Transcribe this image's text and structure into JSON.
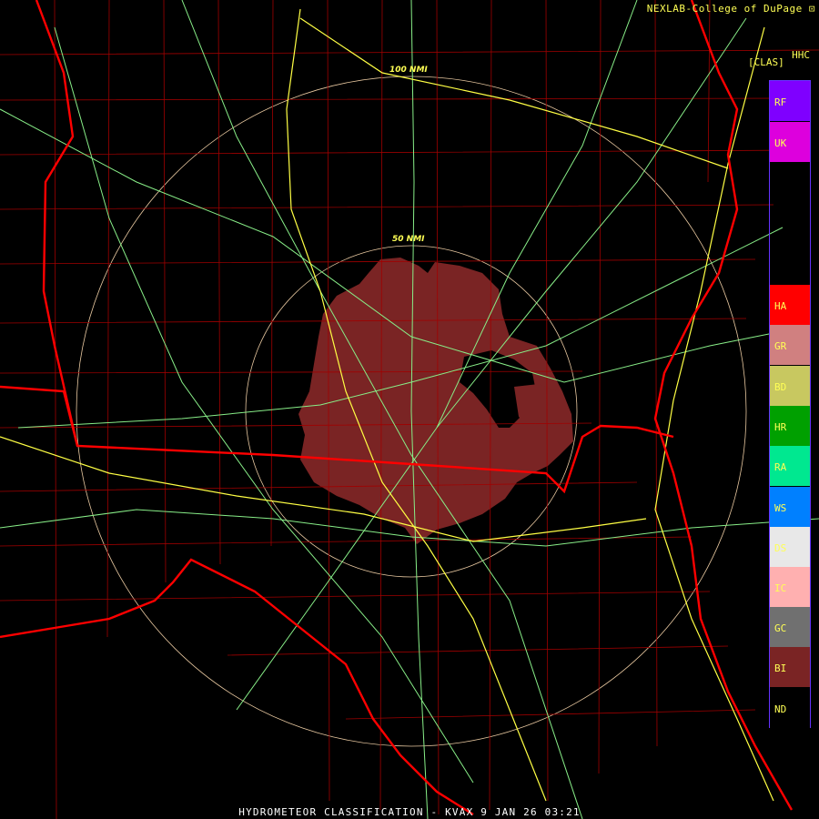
{
  "header": {
    "credit": "NEXLAB-College of DuPage",
    "product_code": "HHC",
    "legend_title": "[CLAS]"
  },
  "footer": {
    "title": "HYDROMETEOR CLASSIFICATION - KVAX 9 JAN 26 03:21"
  },
  "range_rings": {
    "inner_label": "50 NMI",
    "outer_label": "100 NMI"
  },
  "legend": {
    "items": [
      {
        "code": "RF",
        "color": "#7f00ff"
      },
      {
        "code": "UK",
        "color": "#dd00dd"
      },
      {
        "code": "HA",
        "color": "#ff0000"
      },
      {
        "code": "GR",
        "color": "#d08080"
      },
      {
        "code": "BD",
        "color": "#c8c860"
      },
      {
        "code": "HR",
        "color": "#00a000"
      },
      {
        "code": "RA",
        "color": "#00e890"
      },
      {
        "code": "WS",
        "color": "#0080ff"
      },
      {
        "code": "DS",
        "color": "#e8e8e8"
      },
      {
        "code": "IC",
        "color": "#ffb0b0"
      },
      {
        "code": "GC",
        "color": "#707070"
      },
      {
        "code": "BI",
        "color": "#7a2424"
      },
      {
        "code": "ND",
        "color": "#000000"
      }
    ]
  },
  "colors": {
    "state_border": "#ff0000",
    "county_border": "#a00000",
    "highway": "#88ee88",
    "interstate": "#ffff44",
    "ring": "#e8c8a0",
    "echo": "#7a2424",
    "legend_border": "#6633ff"
  }
}
